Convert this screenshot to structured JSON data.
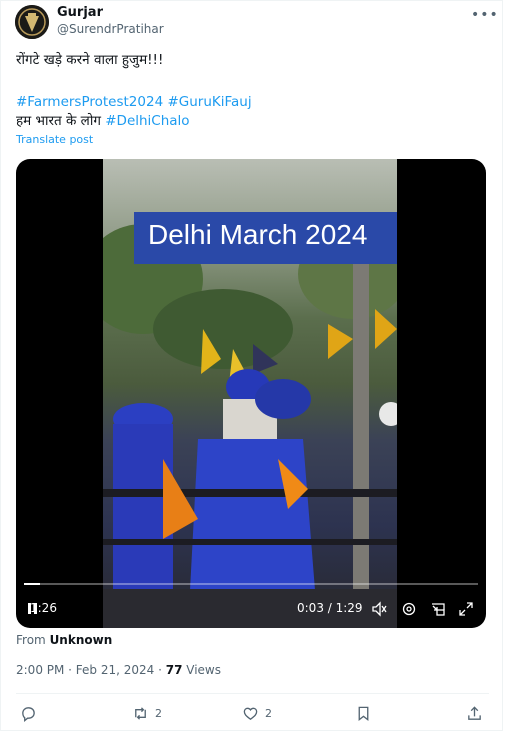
{
  "author": {
    "name": "Gurjar",
    "handle": "@SurendrPratihar",
    "avatar_icon": "avatar-emblem"
  },
  "post": {
    "line1": "रोंगटे खड़े करने वाला हुजुम!!!",
    "hashtags": [
      "#FarmersProtest2024",
      "#GuruKiFauj"
    ],
    "line3_text": "हम भारत के लोग",
    "line3_tag": "#DelhiChalo",
    "translate": "Translate post"
  },
  "video": {
    "banner": "Delhi March 2024",
    "elapsed_overlay": "1:26",
    "time": "0:03 / 1:29",
    "progress": 0.035,
    "icons": [
      "pause-icon",
      "volume-icon",
      "settings-icon",
      "pip-icon",
      "fullscreen-icon"
    ],
    "colors": {
      "banner": "#2a49a8",
      "turban": "#2b3fc2"
    }
  },
  "source": {
    "label": "From",
    "value": "Unknown"
  },
  "meta": {
    "time": "2:00 PM · Feb 21, 2024 · ",
    "views": "77",
    "views_label": " Views"
  },
  "actions": {
    "reply": "",
    "repost": "2",
    "like": "2",
    "bookmark": "",
    "share": ""
  },
  "colors": {
    "link": "#1d9bf0",
    "muted": "#536471",
    "text": "#0f1419"
  }
}
